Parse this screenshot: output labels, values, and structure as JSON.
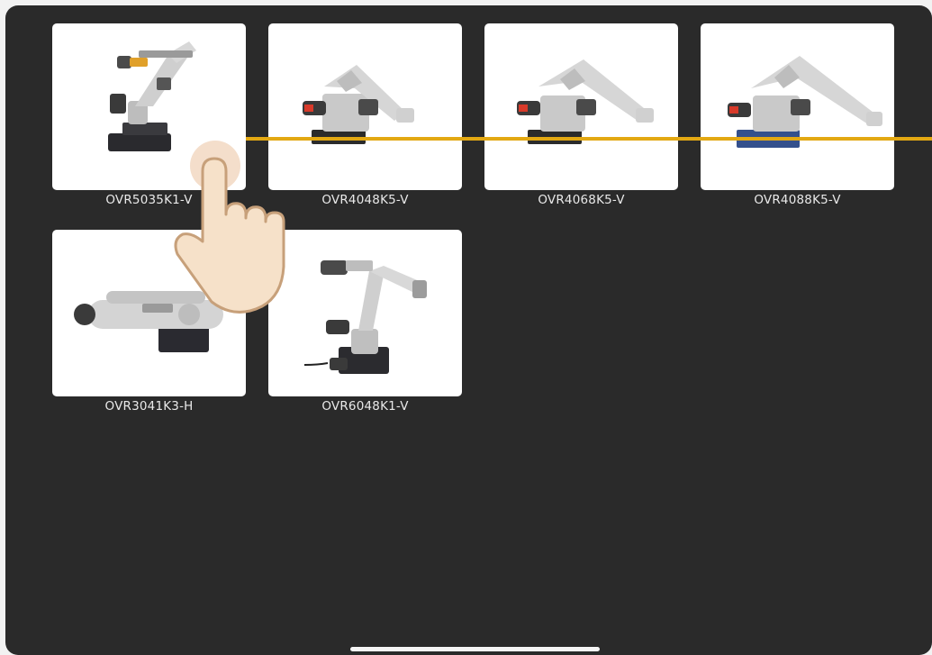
{
  "products": [
    {
      "name": "OVR5035K1-V",
      "icon": "robot-arm-vertical-icon"
    },
    {
      "name": "OVR4048K5-V",
      "icon": "palletizing-robot-icon"
    },
    {
      "name": "OVR4068K5-V",
      "icon": "palletizing-robot-icon"
    },
    {
      "name": "OVR4088K5-V",
      "icon": "palletizing-robot-icon"
    },
    {
      "name": "OVR3041K3-H",
      "icon": "scara-robot-icon"
    },
    {
      "name": "OVR6048K1-V",
      "icon": "six-axis-robot-icon"
    }
  ],
  "colors": {
    "background": "#2a2a2a",
    "card": "#ffffff",
    "label": "#e9e9e9",
    "scan_line": "#e3a812",
    "hand": "#f6e1c9"
  },
  "gesture": {
    "icon": "tap-hand-icon"
  }
}
